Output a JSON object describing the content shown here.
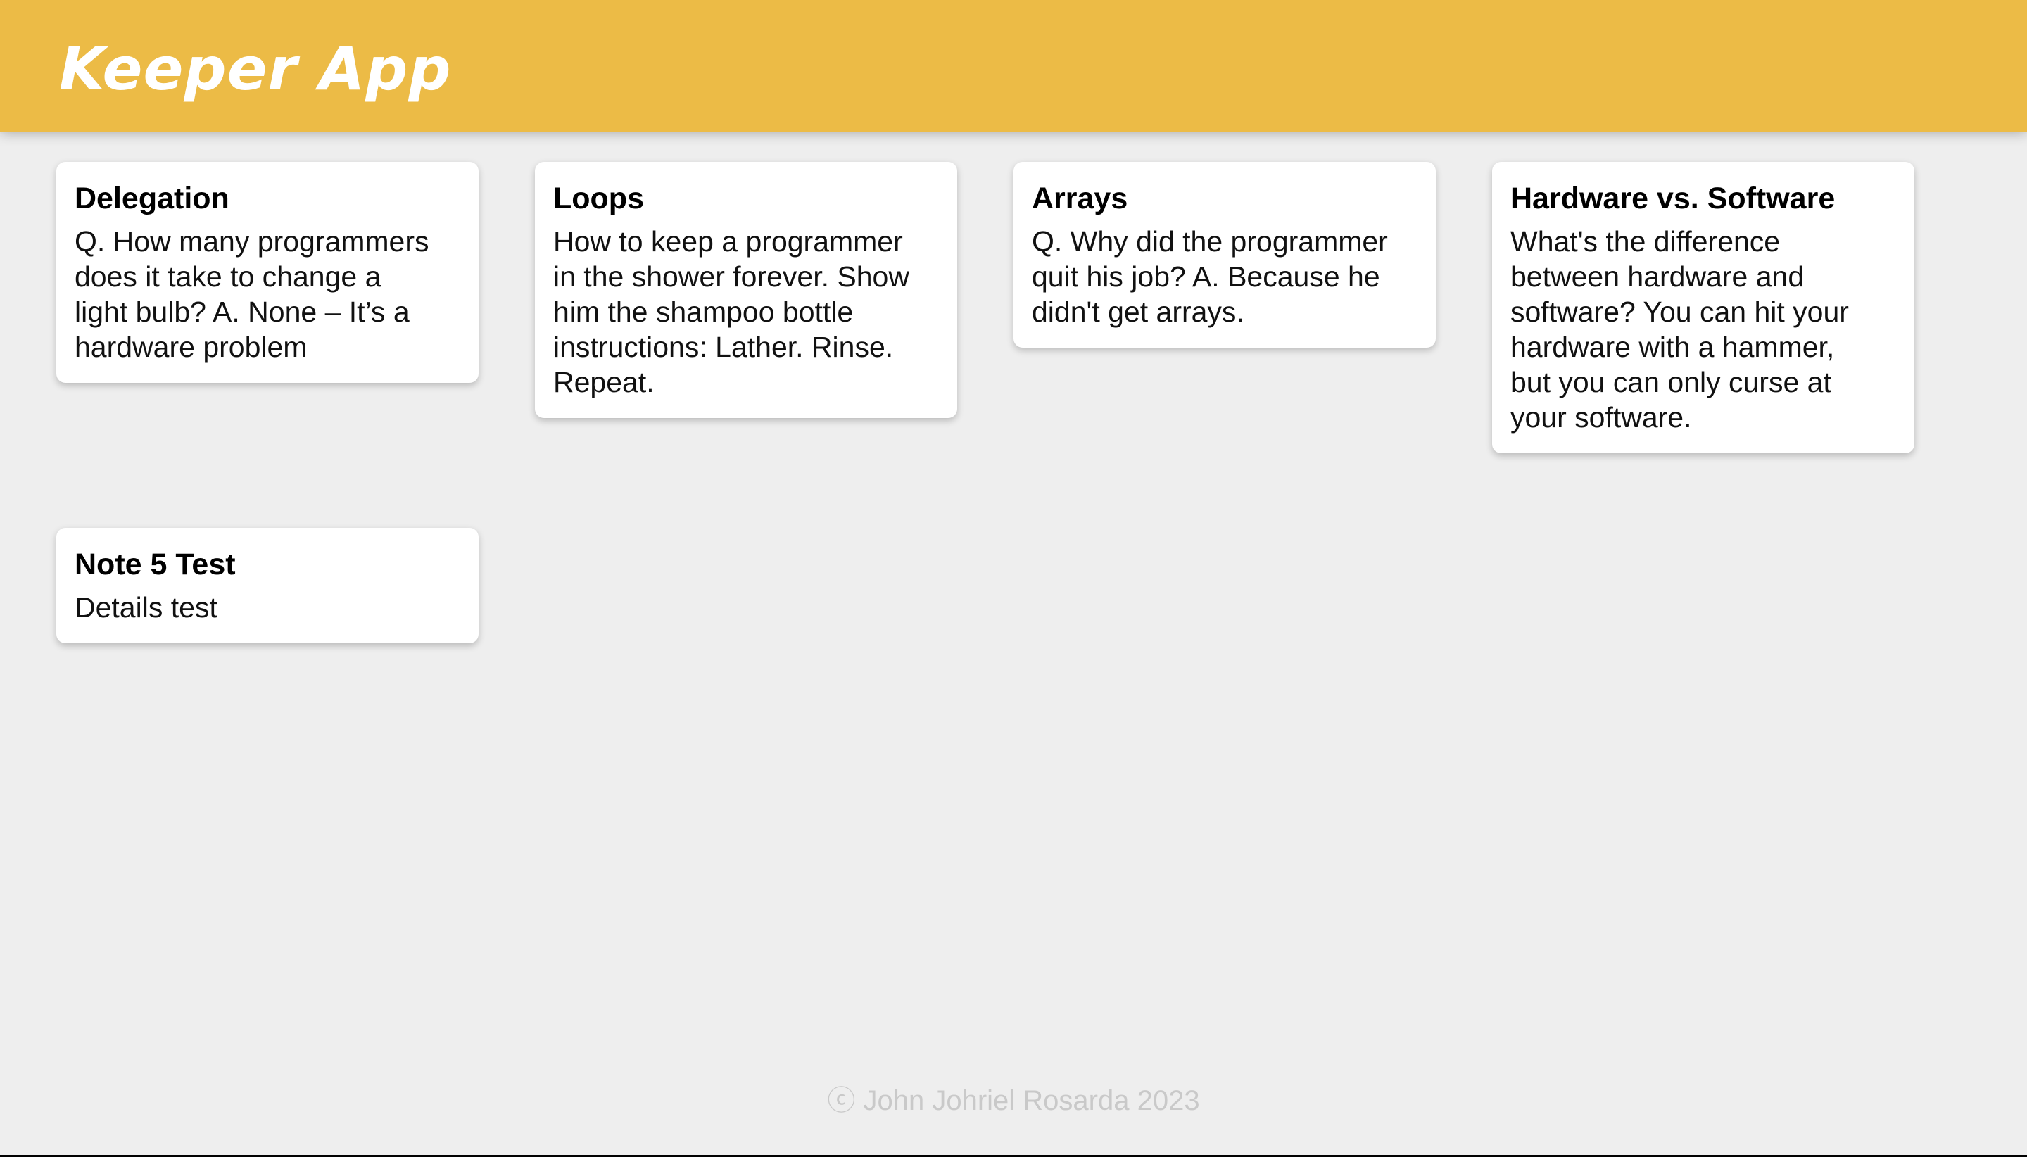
{
  "header": {
    "title": "Keeper App"
  },
  "notes": [
    {
      "title": "Delegation",
      "content": "Q. How many programmers\ndoes it take to change a\nlight bulb? A. None – It’s a\nhardware problem"
    },
    {
      "title": "Loops",
      "content": "How to keep a programmer\nin the shower forever. Show\nhim the shampoo bottle\ninstructions: Lather. Rinse.\nRepeat."
    },
    {
      "title": "Arrays",
      "content": "Q. Why did the programmer\nquit his job? A. Because he\ndidn't get arrays."
    },
    {
      "title": "Hardware vs. Software",
      "content": "What's the difference\nbetween hardware and\nsoftware? You can hit your\nhardware with a hammer,\nbut you can only curse at\nyour software."
    },
    {
      "title": "Note 5 Test",
      "content": "Details test"
    }
  ],
  "footer": {
    "text": "ⓒ John Johriel Rosarda 2023"
  },
  "colors": {
    "header_bg": "#ecbb46",
    "page_bg": "#eeeeee",
    "card_bg": "#ffffff",
    "footer_text": "#c9c9c9"
  }
}
